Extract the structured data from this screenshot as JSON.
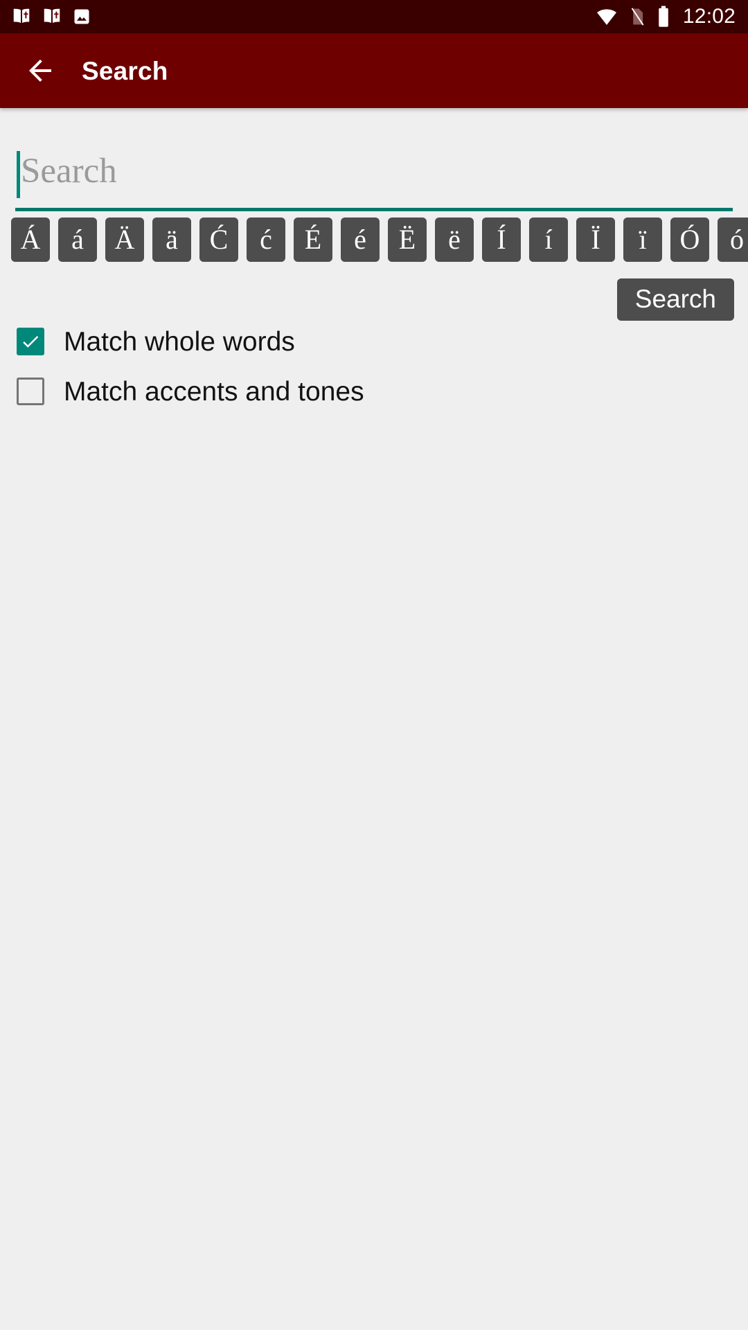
{
  "status_bar": {
    "background": "#3A0000",
    "time": "12:02",
    "notification_icons": [
      "bible-book-icon",
      "bible-book-icon",
      "image-icon"
    ],
    "system_icons": [
      "wifi-icon",
      "no-sim-icon",
      "battery-icon"
    ]
  },
  "app_bar": {
    "background": "#6E0000",
    "back_icon": "back-arrow-icon",
    "title": "Search"
  },
  "search": {
    "value": "",
    "placeholder": "Search",
    "caret_color": "#00897B",
    "underline_color": "#00796B"
  },
  "accent_keys": {
    "background": "#4D4D4D",
    "items": [
      {
        "label": "Á"
      },
      {
        "label": "á"
      },
      {
        "label": "Ä"
      },
      {
        "label": "ä"
      },
      {
        "label": "Ć"
      },
      {
        "label": "ć"
      },
      {
        "label": "É"
      },
      {
        "label": "é"
      },
      {
        "label": "Ë"
      },
      {
        "label": "ë"
      },
      {
        "label": "Í"
      },
      {
        "label": "í"
      },
      {
        "label": "Ï"
      },
      {
        "label": "ï"
      },
      {
        "label": "Ó"
      },
      {
        "label": "ó"
      }
    ]
  },
  "actions": {
    "search_button_label": "Search"
  },
  "options": [
    {
      "label": "Match whole words",
      "checked": true,
      "accent": "#00897B"
    },
    {
      "label": "Match accents and tones",
      "checked": false,
      "accent": "#757575"
    }
  ]
}
